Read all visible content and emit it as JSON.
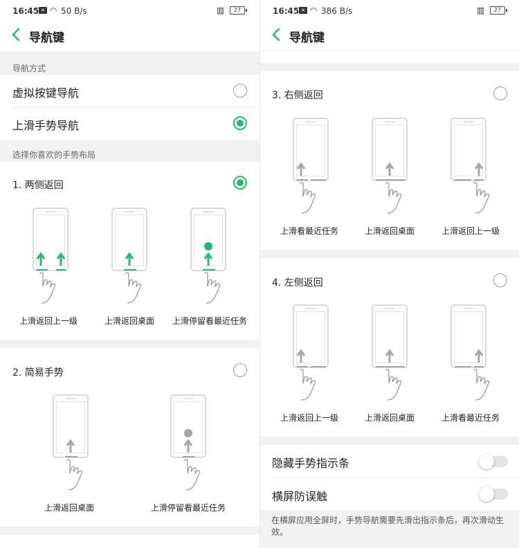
{
  "left": {
    "status": {
      "time": "16:45",
      "speed": "50 B/s",
      "battery": "27"
    },
    "title": "导航键",
    "section_method": "导航方式",
    "options": [
      {
        "label": "虚拟按键导航",
        "selected": false
      },
      {
        "label": "上滑手势导航",
        "selected": true
      }
    ],
    "section_layout": "选择你喜欢的手势布局",
    "gesture1": {
      "label": "1. 两侧返回",
      "selected": true,
      "captions": [
        "上滑返回上一级",
        "上滑返回桌面",
        "上滑停留看最近任务"
      ]
    },
    "gesture2": {
      "label": "2. 简易手势",
      "selected": false,
      "captions": [
        "上滑返回桌面",
        "上滑停留看最近任务"
      ]
    }
  },
  "right": {
    "status": {
      "time": "16:45",
      "speed": "386 B/s",
      "battery": "27"
    },
    "title": "导航键",
    "gesture3": {
      "label": "3. 右侧返回",
      "selected": false,
      "captions": [
        "上滑看最近任务",
        "上滑返回桌面",
        "上滑返回上一级"
      ]
    },
    "gesture4": {
      "label": "4. 左侧返回",
      "selected": false,
      "captions": [
        "上滑返回上一级",
        "上滑返回桌面",
        "上滑看最近任务"
      ]
    },
    "toggles": [
      {
        "label": "隐藏手势指示条",
        "on": false
      },
      {
        "label": "横屏防误触",
        "on": false
      }
    ],
    "footnote": "在横屏应用全屏时，手势导航需要先滑出指示条后，再次滑动生效。"
  },
  "colors": {
    "accent": "#1fbd6e",
    "gray_arrow": "#a6a6a6"
  },
  "icons": [
    "back-chevron-icon",
    "wifi-icon",
    "sim-icon",
    "vibrate-icon",
    "battery-icon",
    "hand-icon",
    "arrow-up-icon"
  ]
}
